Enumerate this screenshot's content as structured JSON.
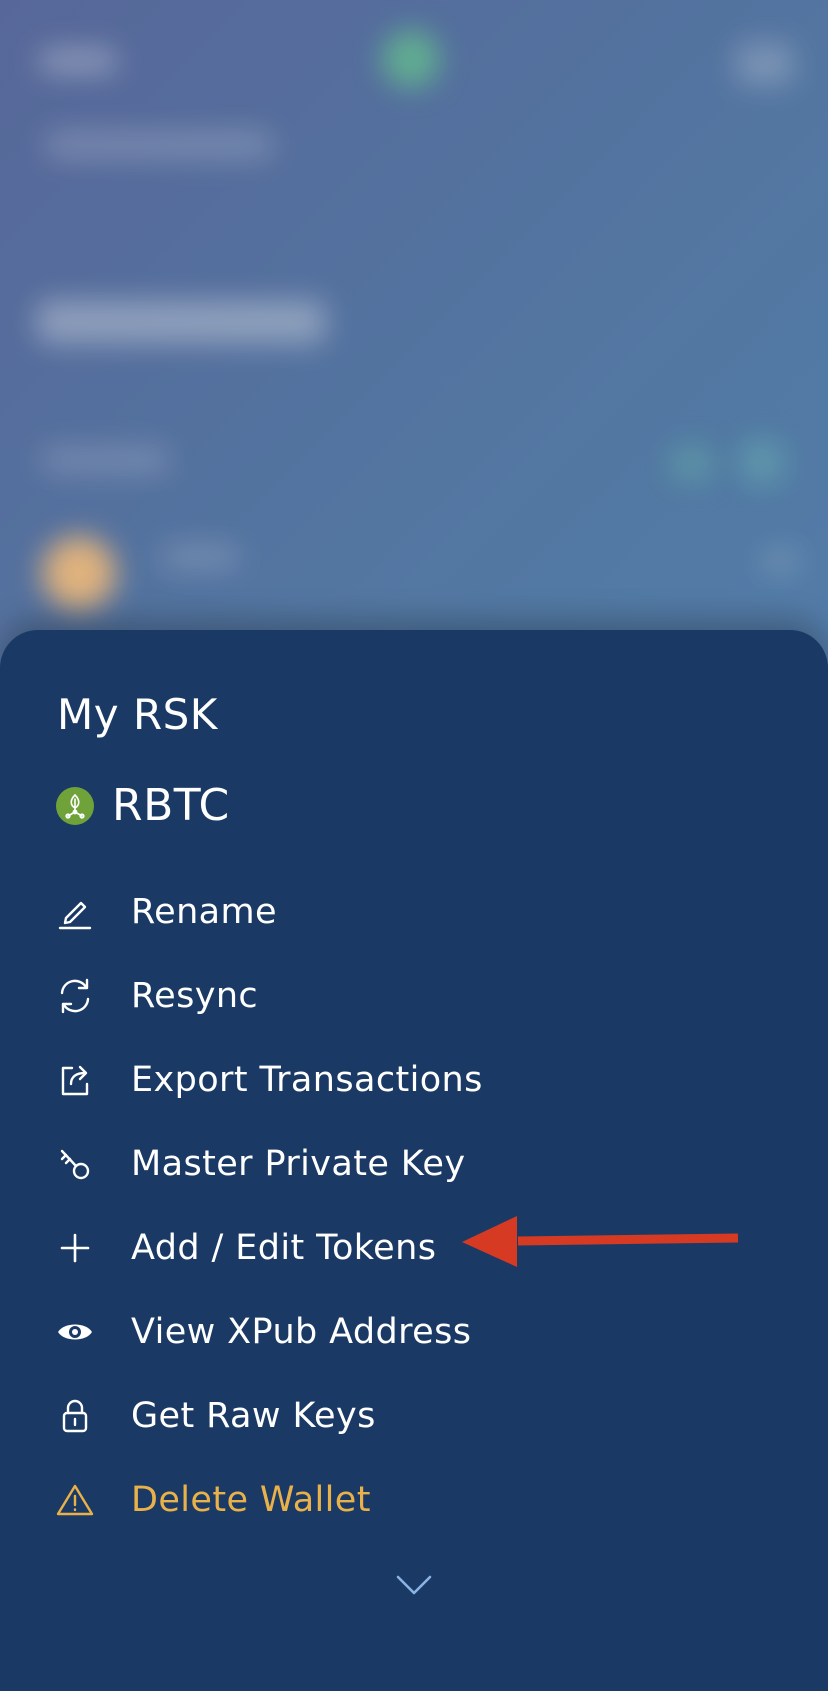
{
  "sheet": {
    "wallet_name": "My RSK",
    "coin": {
      "name": "RBTC",
      "icon": "rsk-logo-icon",
      "color": "#6fa33a"
    },
    "menu": [
      {
        "label": "Rename",
        "icon": "pencil-icon"
      },
      {
        "label": "Resync",
        "icon": "refresh-icon"
      },
      {
        "label": "Export Transactions",
        "icon": "export-icon"
      },
      {
        "label": "Master Private Key",
        "icon": "key-icon"
      },
      {
        "label": "Add / Edit Tokens",
        "icon": "plus-icon"
      },
      {
        "label": "View XPub Address",
        "icon": "eye-icon"
      },
      {
        "label": "Get Raw Keys",
        "icon": "lock-icon"
      },
      {
        "label": "Delete Wallet",
        "icon": "warning-icon",
        "color": "#e9b14a"
      }
    ],
    "collapse_icon": "chevron-down-icon"
  },
  "annotation": {
    "icon": "red-arrow-left",
    "color": "#d63a22"
  },
  "theme": {
    "sheet_bg": "#1a3a65",
    "text": "#ffffff",
    "danger": "#e9b14a"
  }
}
